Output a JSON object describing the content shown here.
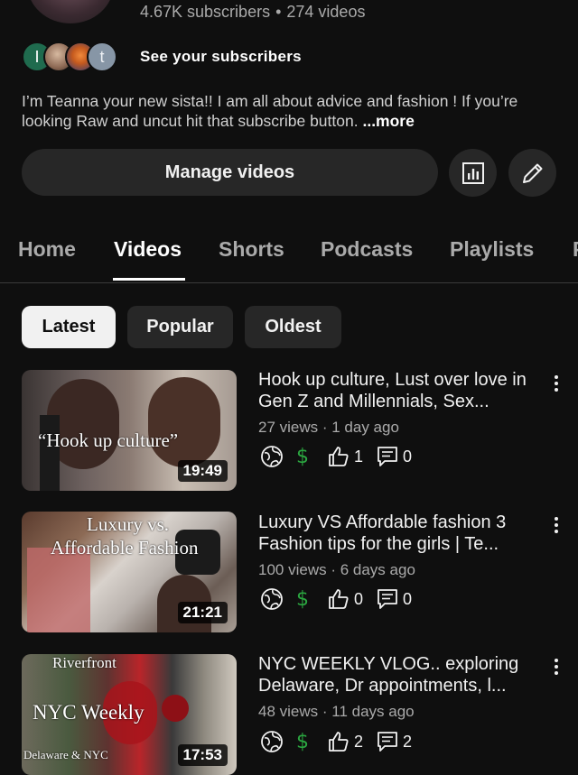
{
  "channel": {
    "subscribers": "4.67K subscribers",
    "separator": "•",
    "videos": "274 videos",
    "see_subscribers": "See your subscribers",
    "subscriber_avatars": [
      {
        "letter": "I",
        "color": "#1f6b4e"
      },
      {
        "letter": "",
        "color": "#8e6a55"
      },
      {
        "letter": "",
        "color": "#c55a1e"
      },
      {
        "letter": "t",
        "color": "#8796a6"
      }
    ],
    "bio": "I’m Teanna your new sista!! I am all about advice and fashion ! If you’re looking Raw and uncut hit that subscribe button.",
    "more": "...more"
  },
  "actions": {
    "manage_videos": "Manage videos",
    "analytics_icon": "analytics-icon",
    "edit_icon": "pencil-icon"
  },
  "tabs": [
    {
      "label": "Home",
      "active": false
    },
    {
      "label": "Videos",
      "active": true
    },
    {
      "label": "Shorts",
      "active": false
    },
    {
      "label": "Podcasts",
      "active": false
    },
    {
      "label": "Playlists",
      "active": false
    },
    {
      "label": "P",
      "active": false
    }
  ],
  "filters": [
    {
      "label": "Latest",
      "active": true
    },
    {
      "label": "Popular",
      "active": false
    },
    {
      "label": "Oldest",
      "active": false
    }
  ],
  "videos": [
    {
      "title": "Hook up culture, Lust over love in Gen Z and Millennials, Sex...",
      "views": "27 views",
      "age": "1 day ago",
      "duration": "19:49",
      "thumb_text": "“Hook up culture”",
      "likes": "1",
      "comments": "0"
    },
    {
      "title": "Luxury VS Affordable fashion 3 Fashion tips for the girls | Te...",
      "views": "100 views",
      "age": "6 days ago",
      "duration": "21:21",
      "thumb_text": "Luxury vs.",
      "thumb_text2": "Affordable Fashion",
      "likes": "0",
      "comments": "0"
    },
    {
      "title": "NYC WEEKLY VLOG.. exploring Delaware, Dr appointments, l...",
      "views": "48 views",
      "age": "11 days ago",
      "duration": "17:53",
      "thumb_text": "NYC Weekly",
      "thumb_text2": "Riverfront",
      "thumb_text3": "Delaware & NYC",
      "likes": "2",
      "comments": "2"
    }
  ],
  "meta_separator": " · ",
  "dollar_symbol": "$",
  "colors": {
    "background": "#0f0f0f",
    "chip": "#272727",
    "monetized": "#2ba640"
  }
}
